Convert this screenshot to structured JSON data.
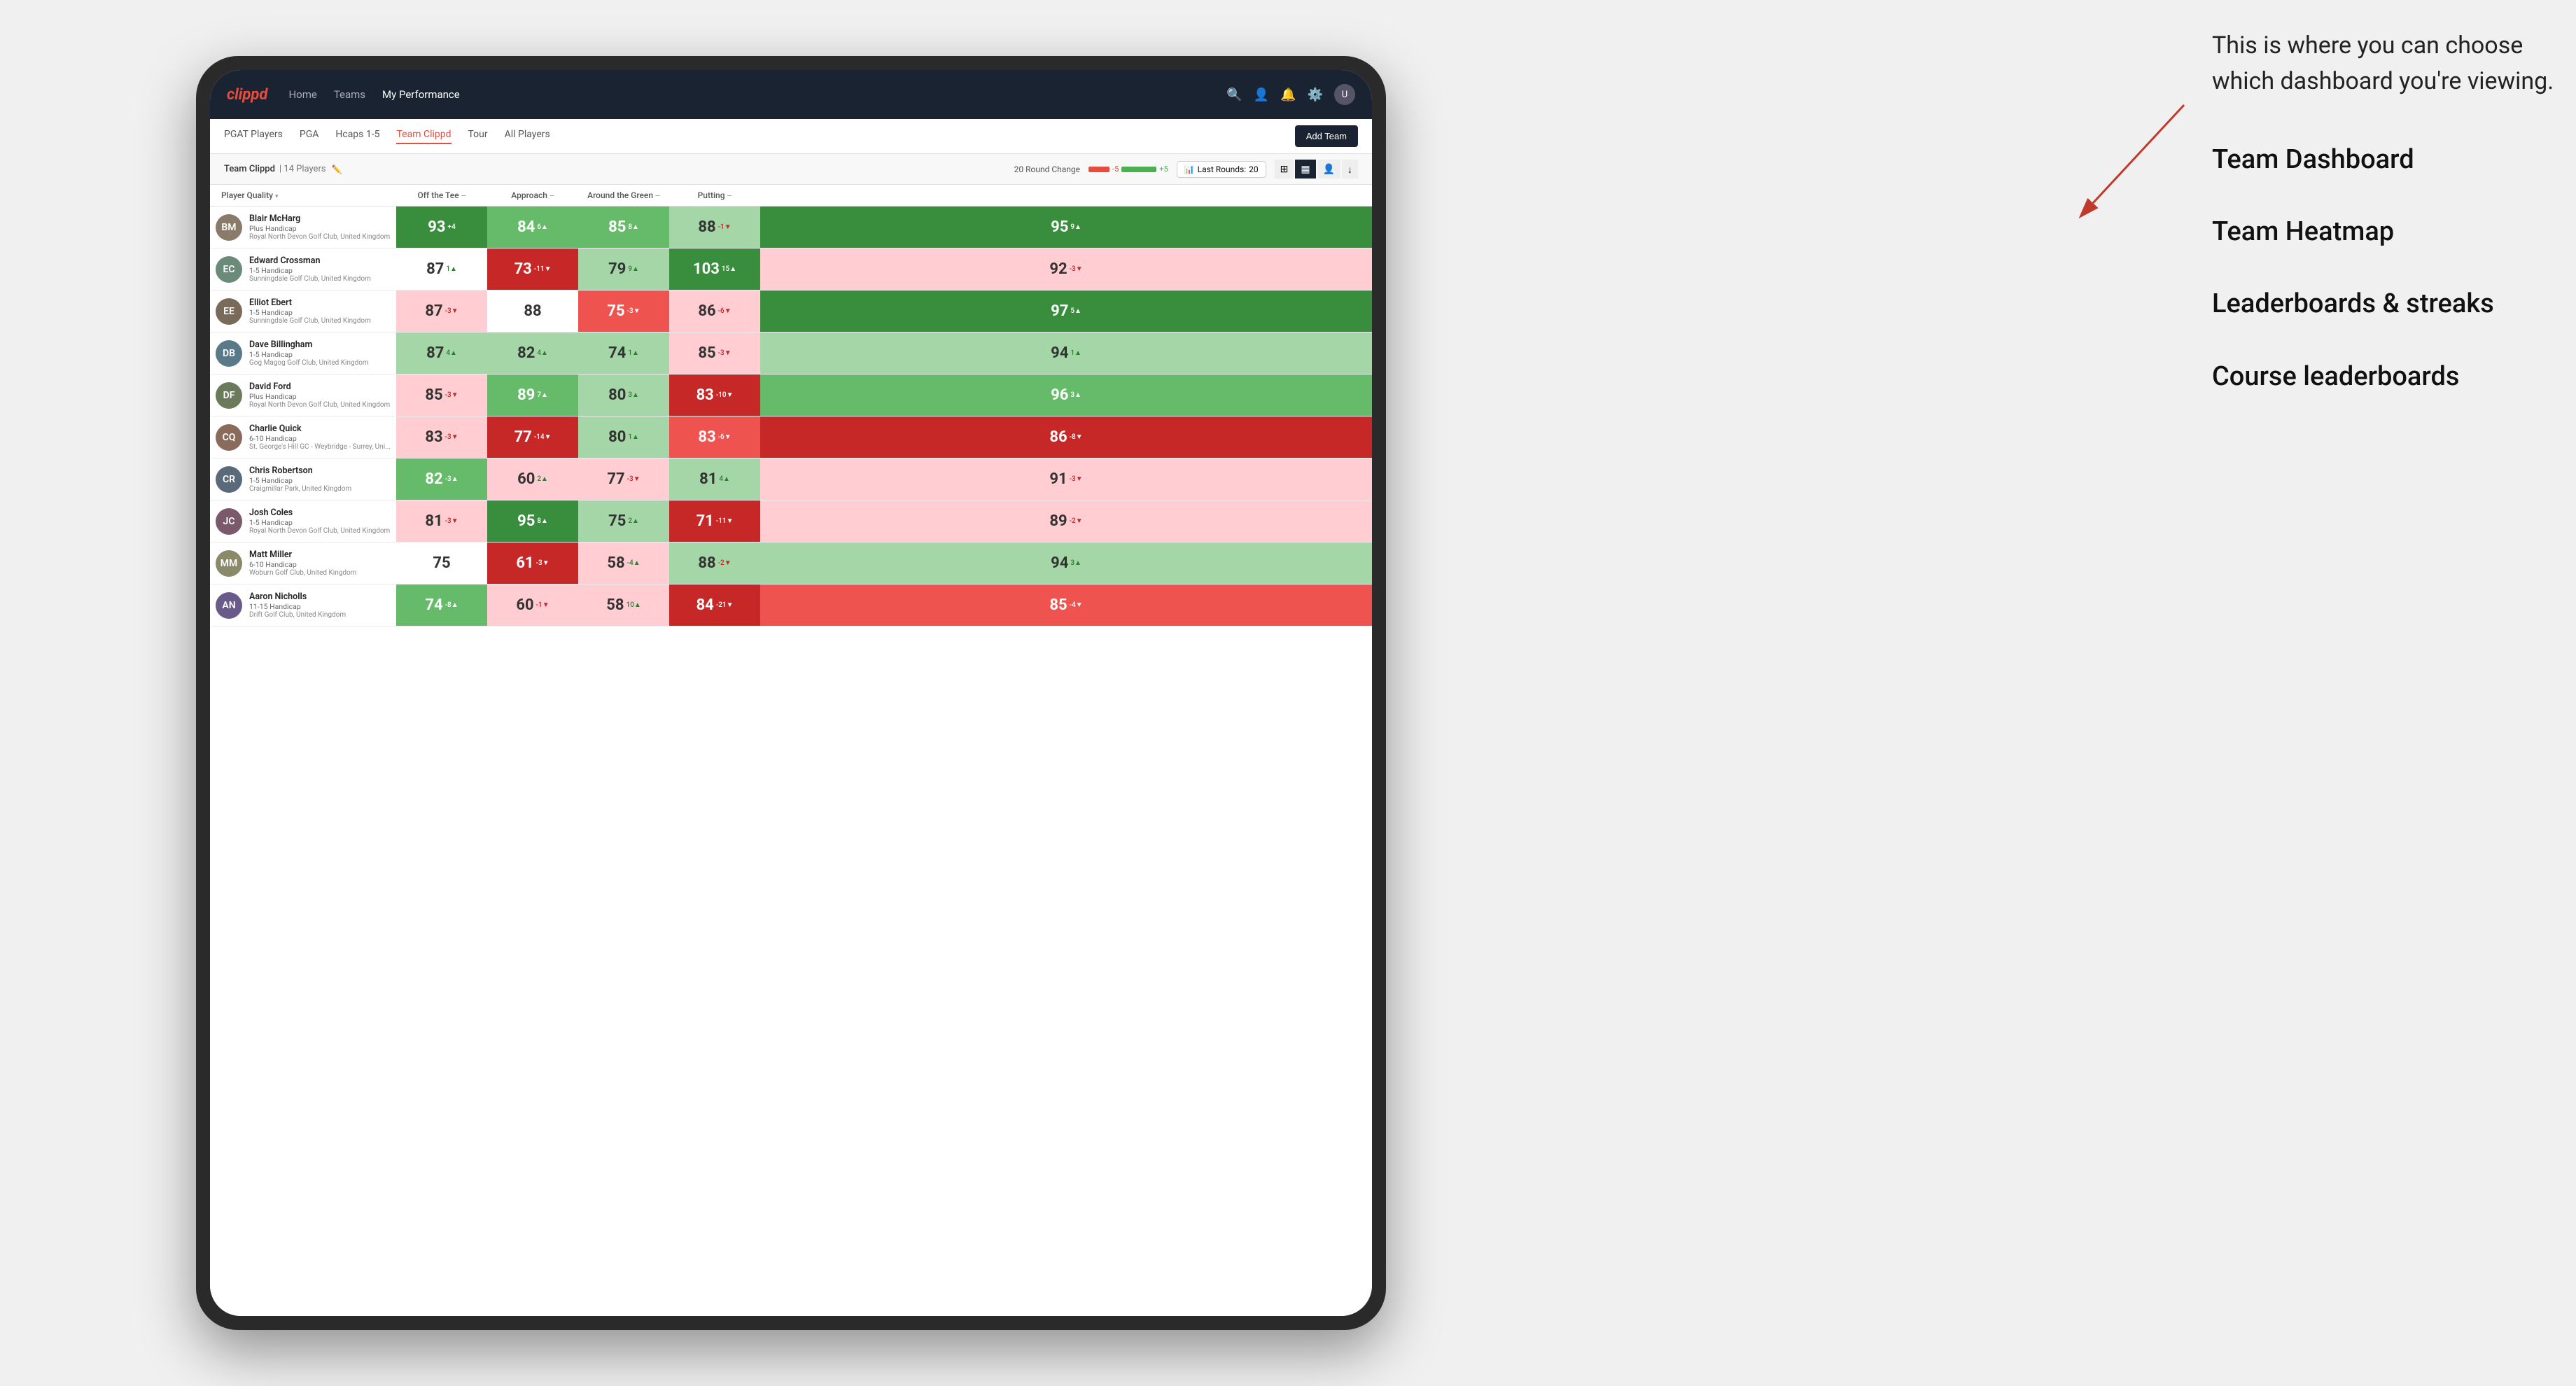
{
  "annotation": {
    "intro": "This is where you can choose which dashboard you're viewing.",
    "menu_items": [
      "Team Dashboard",
      "Team Heatmap",
      "Leaderboards & streaks",
      "Course leaderboards"
    ]
  },
  "nav": {
    "logo": "clippd",
    "links": [
      {
        "label": "Home",
        "active": false
      },
      {
        "label": "Teams",
        "active": false
      },
      {
        "label": "My Performance",
        "active": true
      }
    ],
    "icons": [
      "search",
      "person",
      "notifications",
      "settings",
      "account"
    ]
  },
  "sub_nav": {
    "links": [
      {
        "label": "PGAT Players",
        "active": false
      },
      {
        "label": "PGA",
        "active": false
      },
      {
        "label": "Hcaps 1-5",
        "active": false
      },
      {
        "label": "Team Clippd",
        "active": true
      },
      {
        "label": "Tour",
        "active": false
      },
      {
        "label": "All Players",
        "active": false
      }
    ],
    "add_team_label": "Add Team"
  },
  "team_bar": {
    "name": "Team Clippd",
    "count": "14 Players",
    "round_change_label": "20 Round Change",
    "change_neg": "-5",
    "change_pos": "+5",
    "last_rounds_label": "Last Rounds:",
    "last_rounds_val": "20"
  },
  "table": {
    "columns": [
      {
        "key": "player",
        "label": "Player Quality",
        "sort": true
      },
      {
        "key": "tee",
        "label": "Off the Tee",
        "sort": true
      },
      {
        "key": "approach",
        "label": "Approach",
        "sort": true
      },
      {
        "key": "around",
        "label": "Around the Green",
        "sort": true
      },
      {
        "key": "putting",
        "label": "Putting",
        "sort": true
      }
    ],
    "rows": [
      {
        "name": "Blair McHarg",
        "handicap": "Plus Handicap",
        "club": "Royal North Devon Golf Club, United Kingdom",
        "avatar_color": "#8a7a6a",
        "avatar_initials": "BM",
        "player_quality": {
          "val": 93,
          "change": "+4",
          "dir": "up",
          "bg": "bg-green-dark"
        },
        "tee": {
          "val": 84,
          "change": "6▲",
          "dir": "up",
          "bg": "bg-green-med"
        },
        "approach": {
          "val": 85,
          "change": "8▲",
          "dir": "up",
          "bg": "bg-green-med"
        },
        "around": {
          "val": 88,
          "change": "-1▼",
          "dir": "down",
          "bg": "bg-green-light"
        },
        "putting": {
          "val": 95,
          "change": "9▲",
          "dir": "up",
          "bg": "bg-green-dark"
        }
      },
      {
        "name": "Edward Crossman",
        "handicap": "1-5 Handicap",
        "club": "Sunningdale Golf Club, United Kingdom",
        "avatar_color": "#6a8a7a",
        "avatar_initials": "EC",
        "player_quality": {
          "val": 87,
          "change": "1▲",
          "dir": "up",
          "bg": "bg-white"
        },
        "tee": {
          "val": 73,
          "change": "-11▼",
          "dir": "down",
          "bg": "bg-red-dark"
        },
        "approach": {
          "val": 79,
          "change": "9▲",
          "dir": "up",
          "bg": "bg-green-light"
        },
        "around": {
          "val": 103,
          "change": "15▲",
          "dir": "up",
          "bg": "bg-green-dark"
        },
        "putting": {
          "val": 92,
          "change": "-3▼",
          "dir": "down",
          "bg": "bg-red-light"
        }
      },
      {
        "name": "Elliot Ebert",
        "handicap": "1-5 Handicap",
        "club": "Sunningdale Golf Club, United Kingdom",
        "avatar_color": "#7a6a5a",
        "avatar_initials": "EE",
        "player_quality": {
          "val": 87,
          "change": "-3▼",
          "dir": "down",
          "bg": "bg-red-light"
        },
        "tee": {
          "val": 88,
          "change": "",
          "dir": "",
          "bg": "bg-white"
        },
        "approach": {
          "val": 75,
          "change": "-3▼",
          "dir": "down",
          "bg": "bg-red-med"
        },
        "around": {
          "val": 86,
          "change": "-6▼",
          "dir": "down",
          "bg": "bg-red-light"
        },
        "putting": {
          "val": 97,
          "change": "5▲",
          "dir": "up",
          "bg": "bg-green-dark"
        }
      },
      {
        "name": "Dave Billingham",
        "handicap": "1-5 Handicap",
        "club": "Gog Magog Golf Club, United Kingdom",
        "avatar_color": "#5a7a8a",
        "avatar_initials": "DB",
        "player_quality": {
          "val": 87,
          "change": "4▲",
          "dir": "up",
          "bg": "bg-green-light"
        },
        "tee": {
          "val": 82,
          "change": "4▲",
          "dir": "up",
          "bg": "bg-green-light"
        },
        "approach": {
          "val": 74,
          "change": "1▲",
          "dir": "up",
          "bg": "bg-green-light"
        },
        "around": {
          "val": 85,
          "change": "-3▼",
          "dir": "down",
          "bg": "bg-red-light"
        },
        "putting": {
          "val": 94,
          "change": "1▲",
          "dir": "up",
          "bg": "bg-green-light"
        }
      },
      {
        "name": "David Ford",
        "handicap": "Plus Handicap",
        "club": "Royal North Devon Golf Club, United Kingdom",
        "avatar_color": "#6a7a5a",
        "avatar_initials": "DF",
        "player_quality": {
          "val": 85,
          "change": "-3▼",
          "dir": "down",
          "bg": "bg-red-light"
        },
        "tee": {
          "val": 89,
          "change": "7▲",
          "dir": "up",
          "bg": "bg-green-med"
        },
        "approach": {
          "val": 80,
          "change": "3▲",
          "dir": "up",
          "bg": "bg-green-light"
        },
        "around": {
          "val": 83,
          "change": "-10▼",
          "dir": "down",
          "bg": "bg-red-dark"
        },
        "putting": {
          "val": 96,
          "change": "3▲",
          "dir": "up",
          "bg": "bg-green-med"
        }
      },
      {
        "name": "Charlie Quick",
        "handicap": "6-10 Handicap",
        "club": "St. George's Hill GC - Weybridge - Surrey, Uni...",
        "avatar_color": "#8a6a5a",
        "avatar_initials": "CQ",
        "player_quality": {
          "val": 83,
          "change": "-3▼",
          "dir": "down",
          "bg": "bg-red-light"
        },
        "tee": {
          "val": 77,
          "change": "-14▼",
          "dir": "down",
          "bg": "bg-red-dark"
        },
        "approach": {
          "val": 80,
          "change": "1▲",
          "dir": "up",
          "bg": "bg-green-light"
        },
        "around": {
          "val": 83,
          "change": "-6▼",
          "dir": "down",
          "bg": "bg-red-med"
        },
        "putting": {
          "val": 86,
          "change": "-8▼",
          "dir": "down",
          "bg": "bg-red-dark"
        }
      },
      {
        "name": "Chris Robertson",
        "handicap": "1-5 Handicap",
        "club": "Craigmillar Park, United Kingdom",
        "avatar_color": "#5a6a7a",
        "avatar_initials": "CR",
        "player_quality": {
          "val": 82,
          "change": "-3▲",
          "dir": "up",
          "bg": "bg-green-med"
        },
        "tee": {
          "val": 60,
          "change": "2▲",
          "dir": "up",
          "bg": "bg-red-light"
        },
        "approach": {
          "val": 77,
          "change": "-3▼",
          "dir": "down",
          "bg": "bg-red-light"
        },
        "around": {
          "val": 81,
          "change": "4▲",
          "dir": "up",
          "bg": "bg-green-light"
        },
        "putting": {
          "val": 91,
          "change": "-3▼",
          "dir": "down",
          "bg": "bg-red-light"
        }
      },
      {
        "name": "Josh Coles",
        "handicap": "1-5 Handicap",
        "club": "Royal North Devon Golf Club, United Kingdom",
        "avatar_color": "#7a5a6a",
        "avatar_initials": "JC",
        "player_quality": {
          "val": 81,
          "change": "-3▼",
          "dir": "down",
          "bg": "bg-red-light"
        },
        "tee": {
          "val": 95,
          "change": "8▲",
          "dir": "up",
          "bg": "bg-green-dark"
        },
        "approach": {
          "val": 75,
          "change": "2▲",
          "dir": "up",
          "bg": "bg-green-light"
        },
        "around": {
          "val": 71,
          "change": "-11▼",
          "dir": "down",
          "bg": "bg-red-dark"
        },
        "putting": {
          "val": 89,
          "change": "-2▼",
          "dir": "down",
          "bg": "bg-red-light"
        }
      },
      {
        "name": "Matt Miller",
        "handicap": "6-10 Handicap",
        "club": "Woburn Golf Club, United Kingdom",
        "avatar_color": "#8a8a6a",
        "avatar_initials": "MM",
        "player_quality": {
          "val": 75,
          "change": "",
          "dir": "",
          "bg": "bg-white"
        },
        "tee": {
          "val": 61,
          "change": "-3▼",
          "dir": "down",
          "bg": "bg-red-dark"
        },
        "approach": {
          "val": 58,
          "change": "-4▲",
          "dir": "up",
          "bg": "bg-red-light"
        },
        "around": {
          "val": 88,
          "change": "-2▼",
          "dir": "down",
          "bg": "bg-green-light"
        },
        "putting": {
          "val": 94,
          "change": "3▲",
          "dir": "up",
          "bg": "bg-green-light"
        }
      },
      {
        "name": "Aaron Nicholls",
        "handicap": "11-15 Handicap",
        "club": "Drift Golf Club, United Kingdom",
        "avatar_color": "#6a5a8a",
        "avatar_initials": "AN",
        "player_quality": {
          "val": 74,
          "change": "-8▲",
          "dir": "up",
          "bg": "bg-green-med"
        },
        "tee": {
          "val": 60,
          "change": "-1▼",
          "dir": "down",
          "bg": "bg-red-light"
        },
        "approach": {
          "val": 58,
          "change": "10▲",
          "dir": "up",
          "bg": "bg-red-light"
        },
        "around": {
          "val": 84,
          "change": "-21▼",
          "dir": "down",
          "bg": "bg-red-dark"
        },
        "putting": {
          "val": 85,
          "change": "-4▼",
          "dir": "down",
          "bg": "bg-red-med"
        }
      }
    ]
  }
}
